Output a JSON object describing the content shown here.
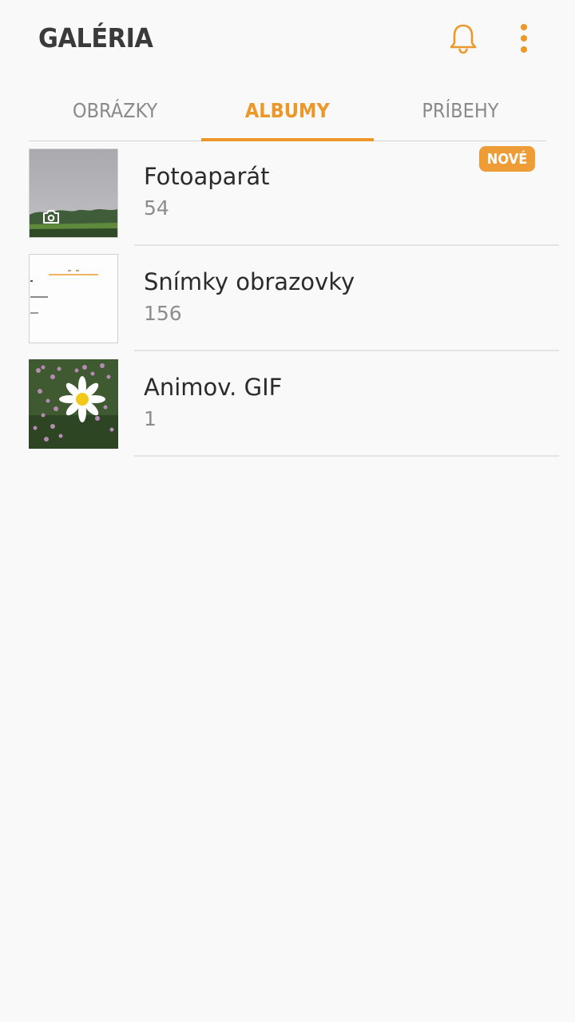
{
  "app": {
    "title": "GALÉRIA",
    "accent_color": "#ec9828",
    "actions": [
      {
        "icon": "bell-icon"
      },
      {
        "icon": "more-vertical-icon"
      }
    ]
  },
  "tabs": [
    {
      "label": "OBRÁZKY",
      "active": false
    },
    {
      "label": "ALBUMY",
      "active": true
    },
    {
      "label": "PRÍBEHY",
      "active": false
    }
  ],
  "albums": [
    {
      "name": "Fotoaparát",
      "count": "54",
      "thumbnail_icon": "camera-icon"
    },
    {
      "name": "Snímky obrazovky",
      "count": "156",
      "badge": "NOVÉ"
    },
    {
      "name": "Animov. GIF",
      "count": "1"
    }
  ]
}
